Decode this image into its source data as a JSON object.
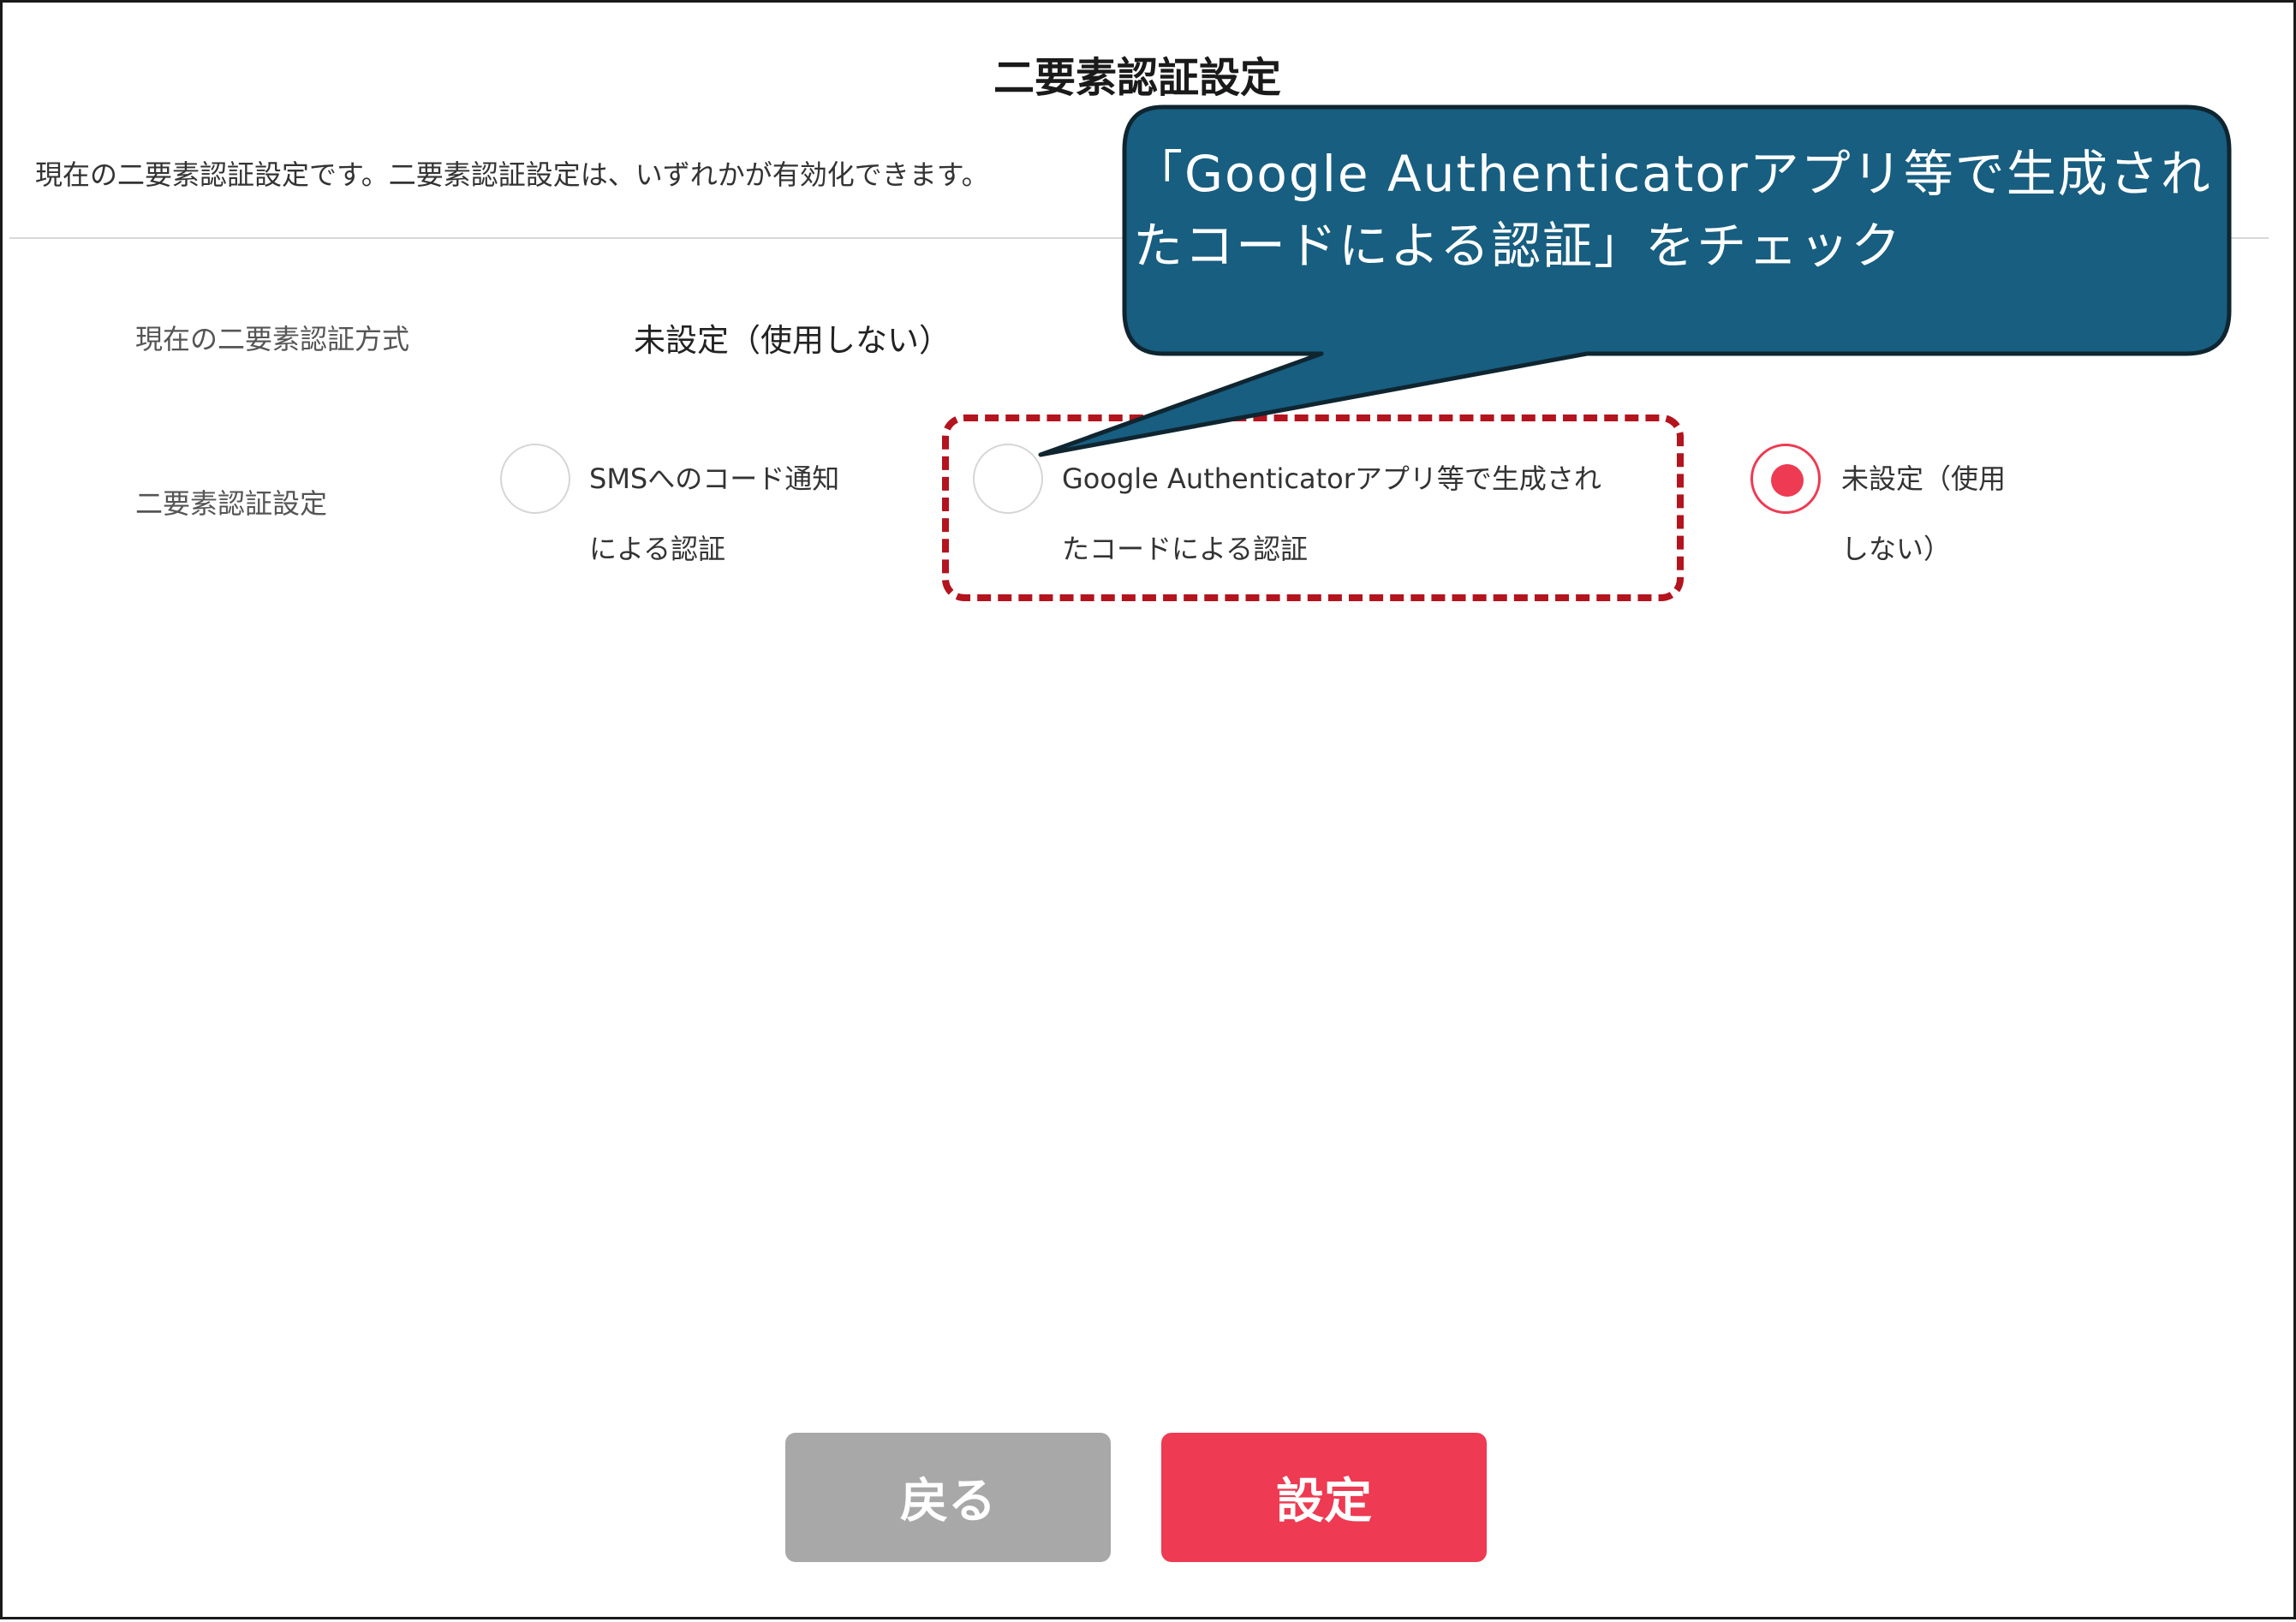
{
  "header": {
    "title": "二要素認証設定",
    "description": "現在の二要素認証設定です。二要素認証設定は、いずれかが有効化できます。"
  },
  "current_method": {
    "label": "現在の二要素認証方式",
    "value": "未設定（使用しない）"
  },
  "setting": {
    "label": "二要素認証設定",
    "options": [
      {
        "line1": "SMSへのコード通知",
        "line2": "による認証",
        "checked": false
      },
      {
        "line1": "Google Authenticatorアプリ等で生成され",
        "line2": "たコードによる認証",
        "checked": false
      },
      {
        "line1": "未設定（使用",
        "line2": "しない）",
        "checked": true
      }
    ]
  },
  "callout": {
    "line1": "「Google Authenticatorアプリ等で生成され",
    "line2": "たコードによる認証」をチェック"
  },
  "buttons": {
    "back_label": "戻る",
    "set_label": "設定"
  },
  "colors": {
    "accent": "#ee3a52",
    "callout_fill": "#175e80",
    "highlight_border": "#b3141e",
    "back_button": "#a8a8a8"
  }
}
